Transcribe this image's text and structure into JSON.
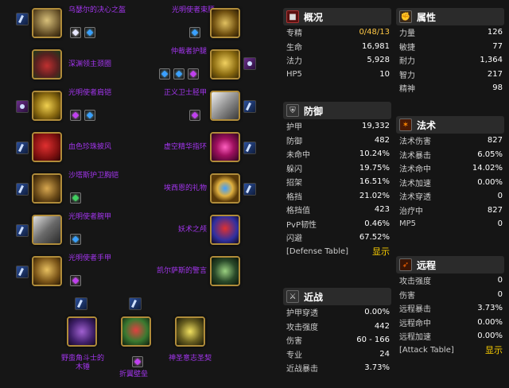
{
  "gear": {
    "left": [
      {
        "name": "乌瑟尔的决心之盔"
      },
      {
        "name": "深渊领主颈圈"
      },
      {
        "name": "光明使者肩铠"
      },
      {
        "name": "血色珍珠披风"
      },
      {
        "name": "沙塔斯护卫胸铠"
      },
      {
        "name": "光明使者腕甲"
      },
      {
        "name": "光明使者手甲"
      }
    ],
    "right": [
      {
        "name": "光明使者束腰"
      },
      {
        "name": "仲裁者护腿"
      },
      {
        "name": "正义卫士胫甲"
      },
      {
        "name": "虚空精华指环"
      },
      {
        "name": "埃西恩的礼物"
      },
      {
        "name": "妖术之颅"
      },
      {
        "name": "凯尔萨斯的警言"
      }
    ],
    "bottom": [
      {
        "name": "野蛮角斗士的木锤"
      },
      {
        "name": "折翼壁垒"
      },
      {
        "name": "神圣意志圣契"
      }
    ]
  },
  "panels": {
    "overview": {
      "title": "概况",
      "rows": [
        {
          "k": "专精",
          "v": "0/48/13"
        },
        {
          "k": "生命",
          "v": "16,981"
        },
        {
          "k": "法力",
          "v": "5,928"
        },
        {
          "k": "HP5",
          "v": "10"
        }
      ]
    },
    "attributes": {
      "title": "属性",
      "rows": [
        {
          "k": "力量",
          "v": "126"
        },
        {
          "k": "敏捷",
          "v": "77"
        },
        {
          "k": "耐力",
          "v": "1,364"
        },
        {
          "k": "智力",
          "v": "217"
        },
        {
          "k": "精神",
          "v": "98"
        }
      ]
    },
    "defense": {
      "title": "防御",
      "rows": [
        {
          "k": "护甲",
          "v": "19,332"
        },
        {
          "k": "防御",
          "v": "482"
        },
        {
          "k": "未命中",
          "v": "10.24%"
        },
        {
          "k": "躲闪",
          "v": "19.75%"
        },
        {
          "k": "招架",
          "v": "16.51%"
        },
        {
          "k": "格挡",
          "v": "21.02%"
        },
        {
          "k": "格挡值",
          "v": "423"
        },
        {
          "k": "PvP韧性",
          "v": "0.46%"
        },
        {
          "k": "闪避",
          "v": "67.52%"
        }
      ],
      "table_label": "[Defense Table]",
      "show_label": "显示"
    },
    "spell": {
      "title": "法术",
      "rows": [
        {
          "k": "法术伤害",
          "v": "827"
        },
        {
          "k": "法术暴击",
          "v": "6.05%"
        },
        {
          "k": "法术命中",
          "v": "14.02%"
        },
        {
          "k": "法术加速",
          "v": "0.00%"
        },
        {
          "k": "法术穿透",
          "v": "0"
        },
        {
          "k": "治疗中",
          "v": "827"
        },
        {
          "k": "MP5",
          "v": "0"
        }
      ]
    },
    "melee": {
      "title": "近战",
      "rows": [
        {
          "k": "护甲穿透",
          "v": "0.00%"
        },
        {
          "k": "攻击强度",
          "v": "442"
        },
        {
          "k": "伤害",
          "v": "60 - 166"
        },
        {
          "k": "专业",
          "v": "24"
        },
        {
          "k": "近战暴击",
          "v": "3.73%"
        }
      ]
    },
    "ranged": {
      "title": "远程",
      "rows": [
        {
          "k": "攻击强度",
          "v": "0"
        },
        {
          "k": "伤害",
          "v": "0"
        },
        {
          "k": "远程暴击",
          "v": "3.73%"
        },
        {
          "k": "远程命中",
          "v": "0.00%"
        },
        {
          "k": "远程加速",
          "v": "0.00%"
        }
      ],
      "table_label": "[Attack Table]",
      "show_label": "显示"
    }
  },
  "colors": {
    "epic": "#a335ee",
    "gold": "#ffc844",
    "border": "#b08c3a"
  }
}
